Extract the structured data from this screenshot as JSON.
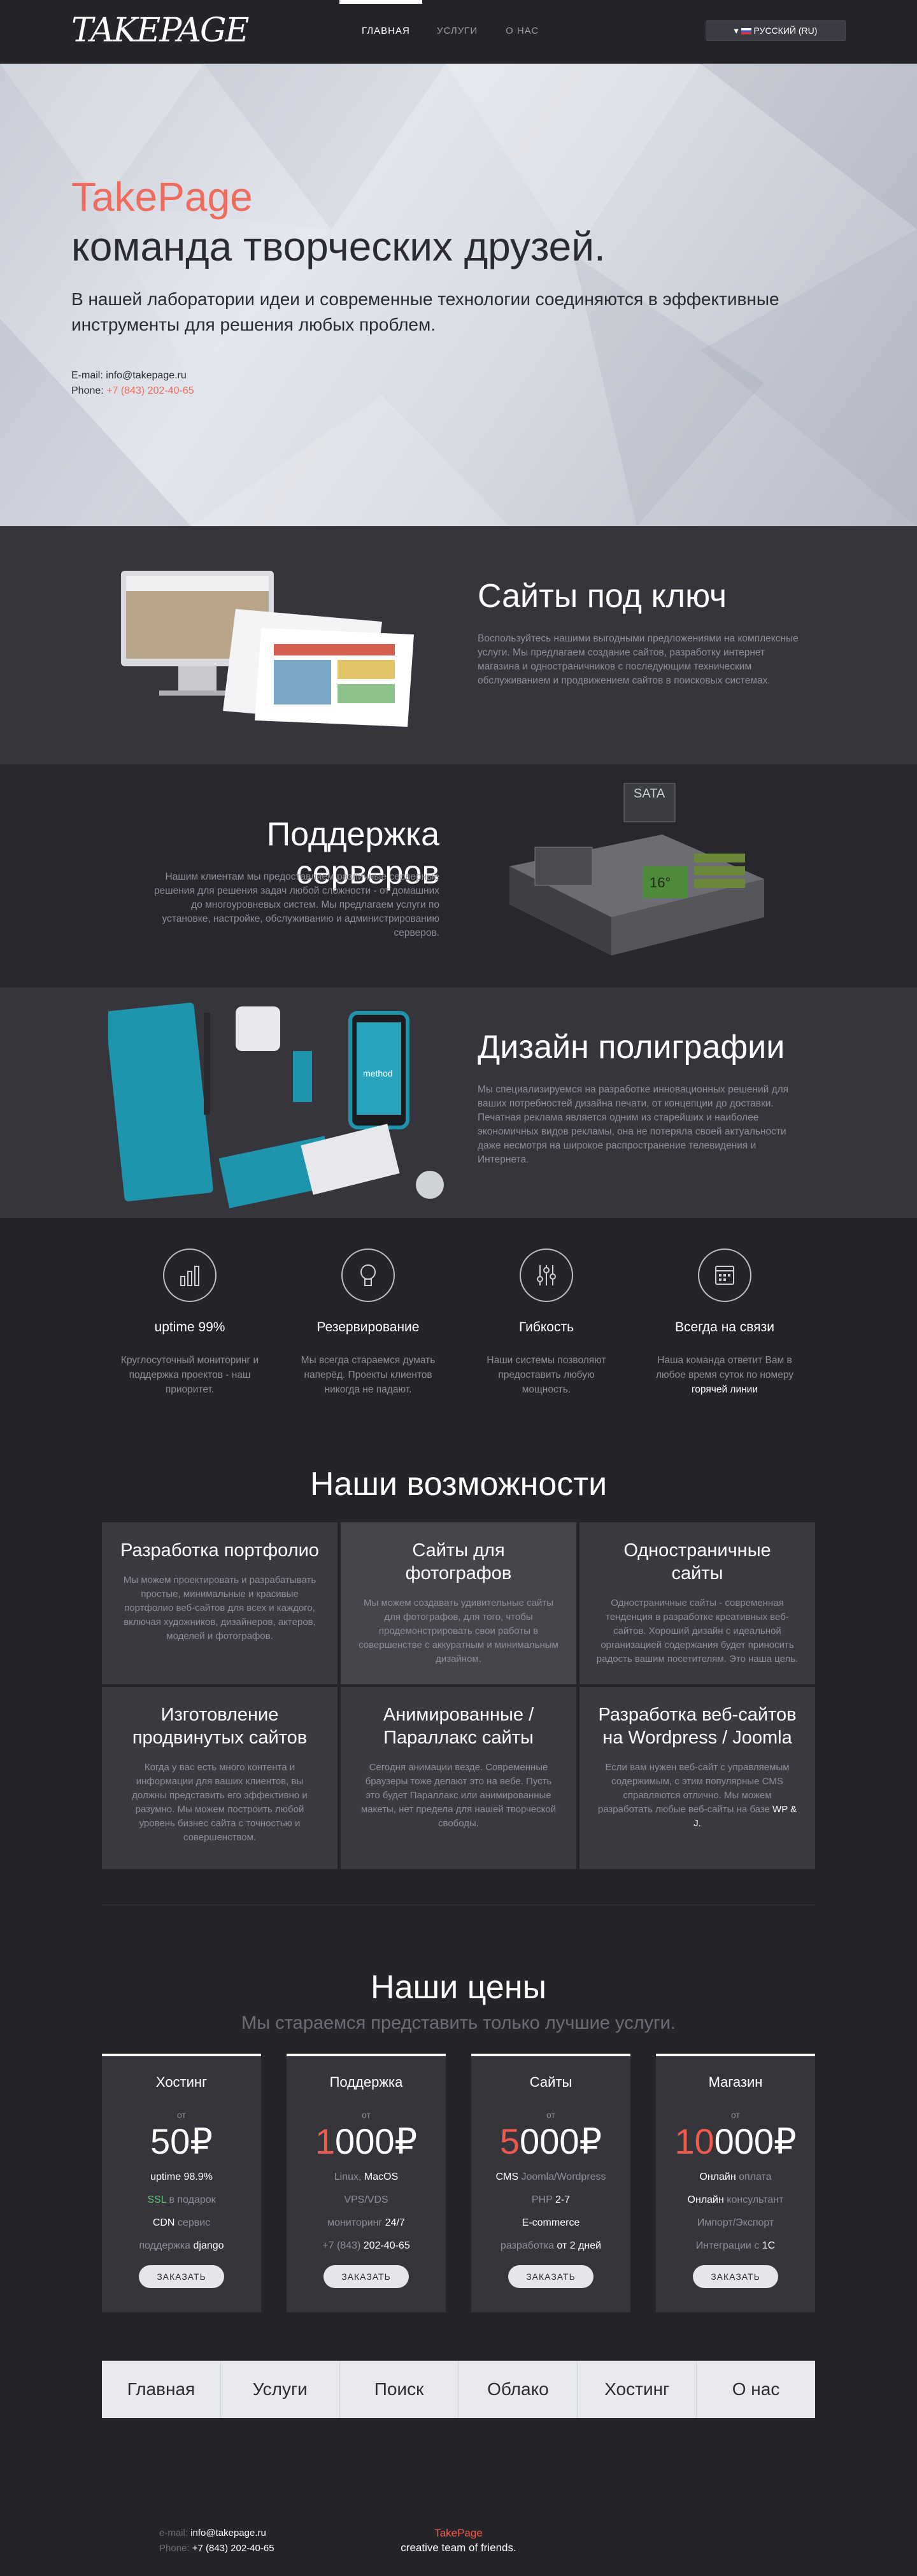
{
  "nav": {
    "logo": "TAKEPAGE",
    "links": [
      "ГЛАВНАЯ",
      "УСЛУГИ",
      "О НАС"
    ],
    "lang": "РУССКИЙ (RU)"
  },
  "hero": {
    "title": "TakePage",
    "subtitle": "команда творческих друзей.",
    "description": "В нашей лаборатории идеи и современные технологии соединяются в эффективные инструменты для решения любых проблем.",
    "email_label": "E-mail: ",
    "email": "info@takepage.ru",
    "phone_label": "Phone: ",
    "phone": "+7 (843) 202-40-65"
  },
  "services": [
    {
      "title": "Сайты под ключ",
      "text": "Воспользуйтесь нашими выгодными предложениями на комплексные услуги. Мы предлагаем создание сайтов, разработку интернет магазина и одностраничников с последующим техническим обслуживанием и продвижением сайтов в поисковых системах."
    },
    {
      "title": "Поддержка серверов",
      "text": "Нашим клиентам мы предоставляем различные серверные решения для решения задач любой сложности - от домашних до многоуровневых систем. Мы предлагаем услуги по установке, настройке, обслуживанию и администрированию серверов."
    },
    {
      "title": "Дизайн полиграфии",
      "text": "Мы специализируемся на разработке инновационных решений для ваших потребностей дизайна печати, от концепции до доставки. Печатная реклама является одним из старейших и наиболее экономичных видов рекламы, она не потеряла своей актуальности даже несмотря на широкое распространение телевидения и Интернета."
    }
  ],
  "server_tags": {
    "sata": "SATA",
    "temp": "16°"
  },
  "brand_word": "method",
  "features": [
    {
      "icon": "bar-chart-icon",
      "title": "uptime 99%",
      "text": "Круглосуточный мониторинг и поддержка проектов - наш приоритет."
    },
    {
      "icon": "lightbulb-icon",
      "title": "Резервирование",
      "text": "Мы всегда стараемся думать наперёд. Проекты клиентов никогда не падают."
    },
    {
      "icon": "sliders-icon",
      "title": "Гибкость",
      "text": "Наши системы позволяют предоставить любую мощность."
    },
    {
      "icon": "calendar-icon",
      "title": "Всегда на связи",
      "text_a": "Наша команда ответит Вам в любое время суток по номеру ",
      "text_b": "горячей линии"
    }
  ],
  "capabilities": {
    "title": "Наши возможности",
    "items": [
      {
        "title": "Разработка портфолио",
        "text": "Мы можем проектировать и разрабатывать простые, минимальные и красивые портфолио веб-сайтов для всех и каждого, включая художников, дизайнеров, актеров, моделей и фотографов."
      },
      {
        "title": "Сайты для фотографов",
        "text": "Мы можем создавать удивительные сайты для фотографов, для того, чтобы продемонстрировать свои работы в совершенстве с аккуратным и минимальным дизайном."
      },
      {
        "title": "Одностраничные сайты",
        "text": "Одностраничные сайты - современная тенденция в разработке креативных веб-сайтов. Хороший дизайн с идеальной организацией содержания будет приносить радость вашим посетителям. Это наша цель."
      },
      {
        "title": "Изготовление продвинутых сайтов",
        "text": "Когда у вас есть много контента и информации для ваших клиентов, вы должны представить его эффективно и разумно. Мы можем построить любой уровень бизнес сайта с точностью и совершенством."
      },
      {
        "title": "Анимированные / Параллакс сайты",
        "text": "Сегодня анимации везде. Современные браузеры тоже делают это на вебе. Пусть это будет Параллакс или анимированные макеты, нет предела для нашей творческой свободы."
      },
      {
        "title": "Разработка веб-сайтов на Wordpress / Joomla",
        "text_a": "Если вам нужен веб-сайт с управляемым содержимым, с этим популярные CMS справляются отлично. Мы можем разработать любые веб-сайты на базе ",
        "text_b": "WP & J."
      }
    ]
  },
  "prices": {
    "title": "Наши цены",
    "subtitle": "Мы стараемся представить только лучшие услуги.",
    "from": "от",
    "button": "ЗАКАЗАТЬ",
    "plans": [
      {
        "name": "Хостинг",
        "red": "",
        "rest": "50₽",
        "lines": [
          [
            "",
            "uptime 98.9%",
            ""
          ],
          [
            "",
            "SSL",
            " в подарок"
          ],
          [
            "",
            "CDN",
            " сервис"
          ],
          [
            "поддержка ",
            "django",
            ""
          ]
        ]
      },
      {
        "name": "Поддержка",
        "red": "1",
        "rest": "000₽",
        "lines": [
          [
            "Linux, ",
            "MacOS",
            ""
          ],
          [
            "VPS/VDS",
            "",
            ""
          ],
          [
            "мониторинг ",
            "24/7",
            ""
          ],
          [
            "+7 (843) ",
            "202-40-65",
            ""
          ]
        ]
      },
      {
        "name": "Сайты",
        "red": "5",
        "rest": "000₽",
        "lines": [
          [
            "",
            "CMS",
            " Joomla/Wordpress"
          ],
          [
            "PHP ",
            "2-7",
            ""
          ],
          [
            "",
            "E-commerce",
            ""
          ],
          [
            "разработка ",
            "от 2 дней",
            ""
          ]
        ]
      },
      {
        "name": "Магазин",
        "red": "10",
        "rest": "000₽",
        "lines": [
          [
            "",
            "Онлайн",
            " оплата"
          ],
          [
            "",
            "Онлайн",
            " консультант"
          ],
          [
            "Импорт/Экспорт",
            "",
            ""
          ],
          [
            "Интеграции с ",
            "1С",
            ""
          ]
        ]
      }
    ]
  },
  "bottom_nav": [
    "Главная",
    "Услуги",
    "Поиск",
    "Облако",
    "Хостинг",
    "О нас"
  ],
  "footer": {
    "email_label": "e-mail: ",
    "email": "info@takepage.ru",
    "phone_label": "Phone: ",
    "phone": "+7 (843) 202-40-65",
    "brand": "TakePage",
    "tagline": "creative team of friends."
  },
  "colors": {
    "accent": "#ef5a4c",
    "bg": "#242429",
    "card": "#35353b"
  }
}
